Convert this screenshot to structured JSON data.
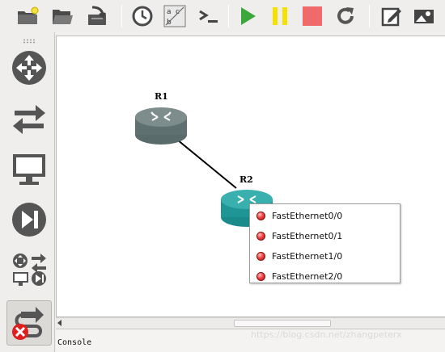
{
  "toolbar": {
    "buttons": [
      "new-project",
      "open-project",
      "save-project",
      "snapshot",
      "show-interface-labels",
      "console-all",
      "start-all",
      "suspend-all",
      "stop-all",
      "reload-all",
      "add-note",
      "insert-picture"
    ],
    "colors": {
      "start": "#3aa83a",
      "suspend": "#f5e000",
      "stop": "#ef6b6b"
    }
  },
  "sidebar": {
    "items": [
      "routers",
      "switches",
      "end-devices",
      "security-devices",
      "all-devices",
      "add-link"
    ],
    "active": "add-link"
  },
  "topology": {
    "nodes": [
      {
        "label": "R1",
        "status": "stopped"
      },
      {
        "label": "R2",
        "status": "stopped"
      }
    ],
    "link": {
      "from": "R1",
      "to": "R2"
    }
  },
  "context_menu": {
    "items": [
      {
        "label": "FastEthernet0/0",
        "status_color": "#e03030"
      },
      {
        "label": "FastEthernet0/1",
        "status_color": "#e03030"
      },
      {
        "label": "FastEthernet1/0",
        "status_color": "#e03030"
      },
      {
        "label": "FastEthernet2/0",
        "status_color": "#e03030"
      }
    ]
  },
  "console": {
    "label": "Console"
  },
  "watermark": "https://blog.csdn.net/zhangpeterx"
}
